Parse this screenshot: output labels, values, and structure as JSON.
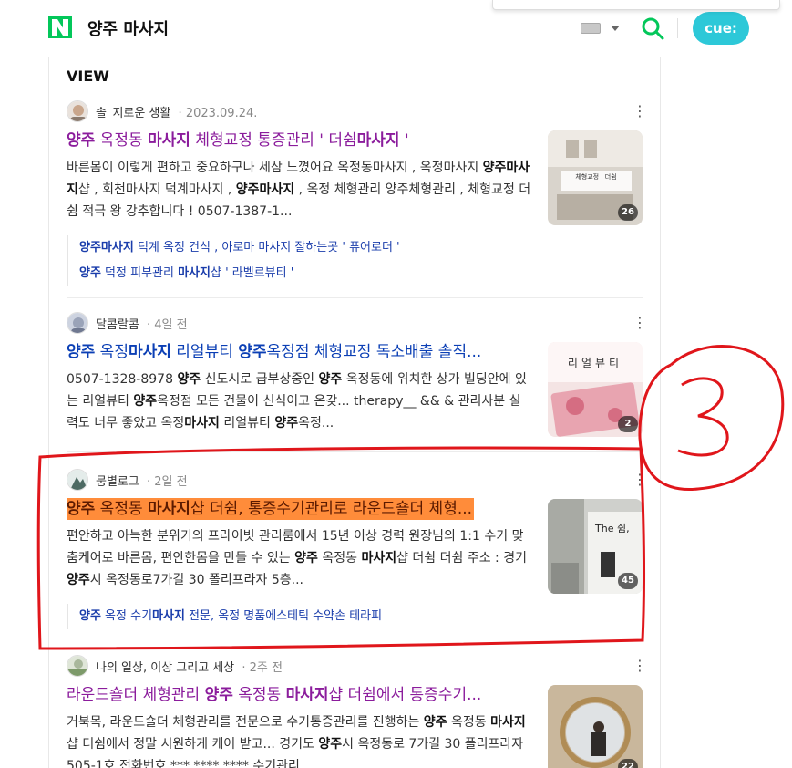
{
  "header": {
    "logo_letter": "N",
    "query": "양주 마사지",
    "cue_label": "cue:"
  },
  "view": {
    "title": "VIEW"
  },
  "posts": [
    {
      "author": "솔_지로운 생활",
      "date": "2023.09.24.",
      "title_parts": [
        "양주",
        " 옥정동 ",
        "마사지",
        " 체형교정 통증관리 ' 더쉼",
        "마사지",
        " '"
      ],
      "desc_html_parts": [
        "바른몸이 이렇게 편하고 중요하구나 세삼 느꼈어요 옥정동마사지 , 옥정마사지 ",
        "양주마사지",
        "샵 , 회천마사지 덕계마사지 , ",
        "양주마사지",
        " , 옥정 체형관리 양주체형관리 , 체형교정 더 쉼 적극 왕 강추합니다 ! 0507-1387-1..."
      ],
      "thumb_count": "26",
      "thumb_caption": "체형교정 · 더쉼",
      "sublinks": [
        {
          "bold": "양주마사지",
          "rest": " 덕계 옥정 건식 , 아로마 마사지 잘하는곳 ' 퓨어로더 '"
        },
        {
          "bold": "양주",
          "rest": " 덕정 피부관리 ",
          "bold2": "마사지",
          "rest2": "샵 ' 라벨르뷰티 '"
        }
      ]
    },
    {
      "author": "달콤랄콤",
      "date": "4일 전",
      "title_parts": [
        "양주",
        " 옥정",
        "마사지",
        " 리얼뷰티 ",
        "양주",
        "옥정점 체형교정 독소배출 솔직..."
      ],
      "desc_html_parts": [
        "0507-1328-8978 ",
        "양주",
        " 신도시로 급부상중인 ",
        "양주",
        " 옥정동에 위치한 상가 빌딩안에 있는 리얼뷰티 ",
        "양주",
        "옥정점 모든 건물이 신식이고 온갖... therapy__ && & 관리사분 실력도 너무 좋았고 옥정",
        "마사지",
        " 리얼뷰티 ",
        "양주",
        "옥정..."
      ],
      "thumb_count": "2",
      "thumb_caption": "리얼뷰티"
    },
    {
      "author": "뭉별로그",
      "date": "2일 전",
      "title_parts": [
        "양주",
        " 옥정동 ",
        "마사지",
        "샵 더쉼, 통증수기관리로 라운드숄더 체형..."
      ],
      "desc_html_parts": [
        "편안하고 아늑한 분위기의 프라이빗 관리룸에서 15년 이상 경력 원장님의 1:1 수기 맞춤케어로 바른몸, 편안한몸을 만들 수 있는 ",
        "양주",
        " 옥정동 ",
        "마사지",
        "샵 더쉼 더쉼 주소 : 경기 ",
        "양주",
        "시 옥정동로7가길 30 폴리프라자 5층..."
      ],
      "thumb_count": "45",
      "thumb_caption": "The 쉼,",
      "sublinks": [
        {
          "bold": "양주",
          "rest": " 옥정 수기",
          "bold2": "마사지",
          "rest2": " 전문, 옥정 명품에스테틱 수약손 테라피"
        }
      ]
    },
    {
      "author": "나의 일상, 이상 그리고 세상",
      "date": "2주 전",
      "title_parts": [
        "라운드숄더 체형관리 ",
        "양주",
        " 옥정동 ",
        "마사지",
        "샵 더쉼에서 통증수기..."
      ],
      "desc_html_parts": [
        "거북목, 라운드숄더 체형관리를 전문으로 수기통증관리를 진행하는 ",
        "양주",
        " 옥정동 ",
        "마사지",
        "샵 더쉼에서 정말 시원하게 케어 받고... 경기도 ",
        "양주",
        "시 옥정동로 7가길 30 폴리프라자 505-1호 전화번호 *** **** **** 수기관리"
      ],
      "thumb_count": "22"
    }
  ],
  "annotation": {
    "number": "3"
  },
  "colors": {
    "naver_green": "#03c75a",
    "title_purple": "#8b1c9c",
    "title_blue": "#0b3fb5",
    "highlight": "#ff8c3a",
    "annotation_red": "#e0161b"
  }
}
